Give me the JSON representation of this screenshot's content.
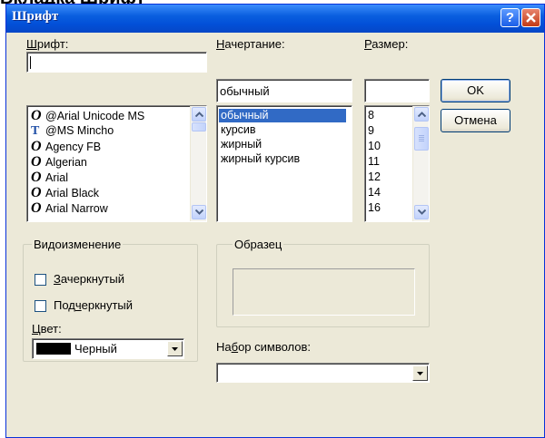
{
  "doc_caption": "Вкладка Шрифт",
  "dialog": {
    "title": "Шрифт",
    "help_label": "?"
  },
  "font": {
    "label_u": "Ш",
    "label_rest": "рифт:",
    "value": "",
    "items": [
      {
        "icon": "opentype-font-icon",
        "name": "@Arial Unicode MS"
      },
      {
        "icon": "truetype-font-icon",
        "name": "@MS Mincho"
      },
      {
        "icon": "opentype-font-icon",
        "name": "Agency FB"
      },
      {
        "icon": "opentype-font-icon",
        "name": "Algerian"
      },
      {
        "icon": "opentype-font-icon",
        "name": "Arial"
      },
      {
        "icon": "opentype-font-icon",
        "name": "Arial Black"
      },
      {
        "icon": "opentype-font-icon",
        "name": "Arial Narrow"
      }
    ]
  },
  "style": {
    "label_u": "Н",
    "label_rest": "ачертание:",
    "value": "обычный",
    "items": [
      "обычный",
      "курсив",
      "жирный",
      "жирный курсив"
    ],
    "selected_index": 0
  },
  "size": {
    "label_u": "Р",
    "label_rest": "азмер:",
    "value": "",
    "items": [
      "8",
      "9",
      "10",
      "11",
      "12",
      "14",
      "16"
    ]
  },
  "buttons": {
    "ok": "OK",
    "cancel": "Отмена"
  },
  "effects": {
    "title": "Видоизменение",
    "strikeout_u": "З",
    "strikeout_rest": "ачеркнутый",
    "underline_pre": "Под",
    "underline_u": "ч",
    "underline_rest": "еркнутый",
    "color_label_u": "Ц",
    "color_label_rest": "вет:",
    "color_value": "Черный",
    "color_swatch": "#000000"
  },
  "sample": {
    "title": "Образец"
  },
  "charset": {
    "label_pre": "На",
    "label_u": "б",
    "label_rest": "ор символов:",
    "value": ""
  }
}
